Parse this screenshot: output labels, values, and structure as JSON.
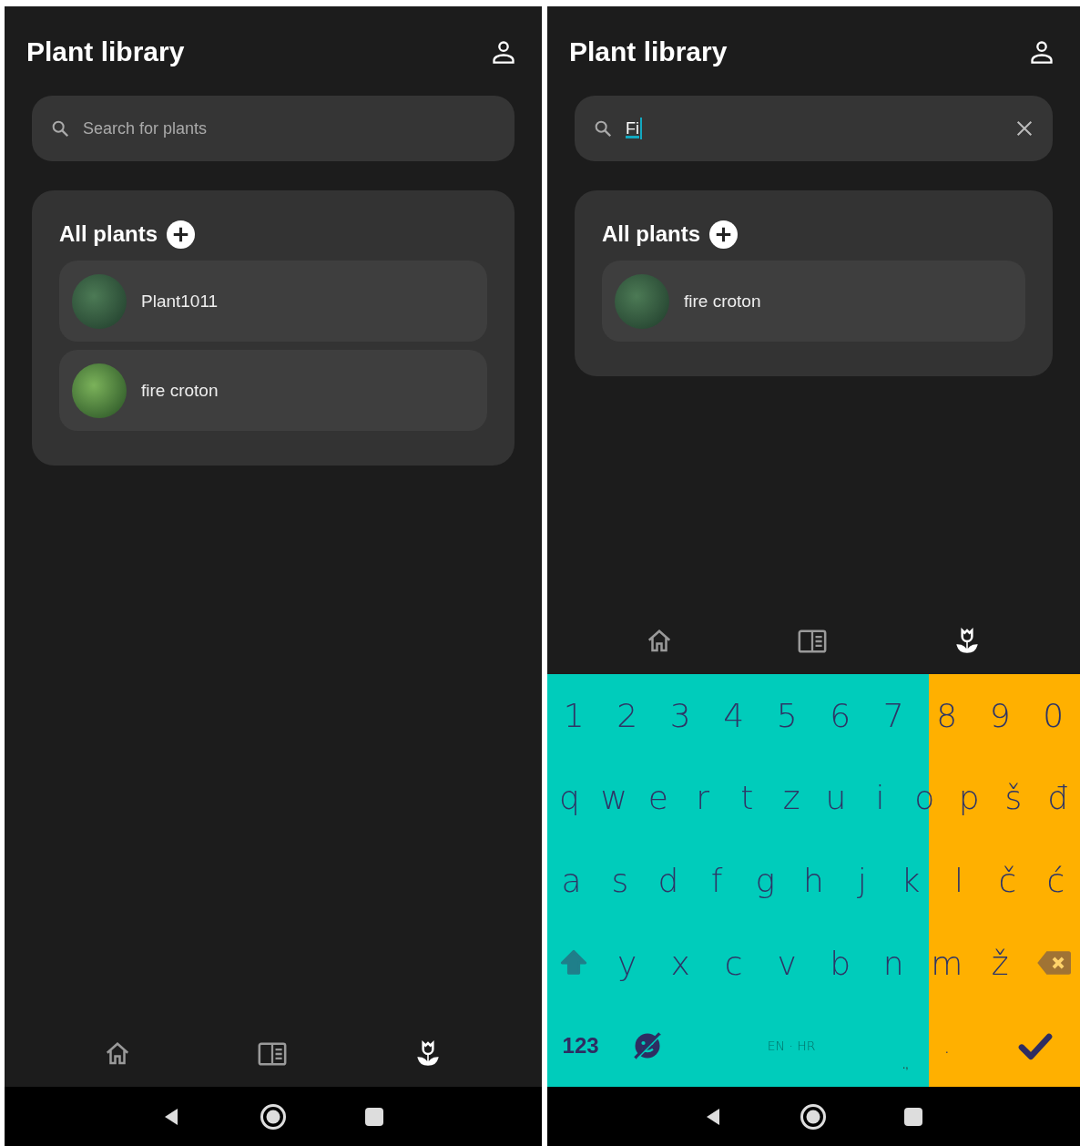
{
  "screens": [
    {
      "title": "Plant library",
      "search": {
        "placeholder": "Search for plants",
        "clearable": false
      },
      "section": {
        "title": "All plants",
        "plants": [
          {
            "name": "Plant1011"
          },
          {
            "name": "fire croton"
          }
        ]
      },
      "nav": [
        {
          "kind": "home",
          "selected": false
        },
        {
          "kind": "library",
          "selected": false
        },
        {
          "kind": "plants",
          "selected": true
        }
      ]
    },
    {
      "title": "Plant library",
      "search": {
        "value": "Fi",
        "clearable": true
      },
      "section": {
        "title": "All plants",
        "plants": [
          {
            "name": "fire croton"
          }
        ]
      },
      "nav": [
        {
          "kind": "home",
          "selected": false
        },
        {
          "kind": "library",
          "selected": false
        },
        {
          "kind": "plants",
          "selected": true
        }
      ],
      "keyboard": {
        "rows": [
          {
            "keys": [
              {
                "kind": "char",
                "label": "1"
              },
              {
                "kind": "char",
                "label": "2"
              },
              {
                "kind": "char",
                "label": "3"
              },
              {
                "kind": "char",
                "label": "4"
              },
              {
                "kind": "char",
                "label": "5"
              },
              {
                "kind": "char",
                "label": "6"
              },
              {
                "kind": "char",
                "label": "7"
              },
              {
                "kind": "char",
                "label": "8"
              },
              {
                "kind": "char",
                "label": "9"
              },
              {
                "kind": "char",
                "label": "0"
              }
            ]
          },
          {
            "keys": [
              {
                "kind": "char",
                "label": "q"
              },
              {
                "kind": "char",
                "label": "w"
              },
              {
                "kind": "char",
                "label": "e"
              },
              {
                "kind": "char",
                "label": "r"
              },
              {
                "kind": "char",
                "label": "t"
              },
              {
                "kind": "char",
                "label": "z"
              },
              {
                "kind": "char",
                "label": "u"
              },
              {
                "kind": "char",
                "label": "i"
              },
              {
                "kind": "char",
                "label": "o"
              },
              {
                "kind": "char",
                "label": "p"
              },
              {
                "kind": "char",
                "label": "š"
              },
              {
                "kind": "char",
                "label": "đ"
              }
            ]
          },
          {
            "keys": [
              {
                "kind": "char",
                "label": "a"
              },
              {
                "kind": "char",
                "label": "s"
              },
              {
                "kind": "char",
                "label": "d"
              },
              {
                "kind": "char",
                "label": "f"
              },
              {
                "kind": "char",
                "label": "g"
              },
              {
                "kind": "char",
                "label": "h"
              },
              {
                "kind": "char",
                "label": "j"
              },
              {
                "kind": "char",
                "label": "k"
              },
              {
                "kind": "char",
                "label": "l"
              },
              {
                "kind": "char",
                "label": "č"
              },
              {
                "kind": "char",
                "label": "ć"
              }
            ]
          },
          {
            "keys": [
              {
                "kind": "shift"
              },
              {
                "kind": "char",
                "label": "y"
              },
              {
                "kind": "char",
                "label": "x"
              },
              {
                "kind": "char",
                "label": "c"
              },
              {
                "kind": "char",
                "label": "v"
              },
              {
                "kind": "char",
                "label": "b"
              },
              {
                "kind": "char",
                "label": "n"
              },
              {
                "kind": "char",
                "label": "m"
              },
              {
                "kind": "char",
                "label": "ž"
              },
              {
                "kind": "backspace"
              }
            ]
          },
          {
            "keys": [
              {
                "kind": "symbols",
                "label": "123"
              },
              {
                "kind": "emoji"
              },
              {
                "kind": "space",
                "label": "EN · HR"
              },
              {
                "kind": "period",
                "label": ".",
                "hint": ".,"
              },
              {
                "kind": "enter"
              }
            ]
          }
        ]
      }
    }
  ]
}
